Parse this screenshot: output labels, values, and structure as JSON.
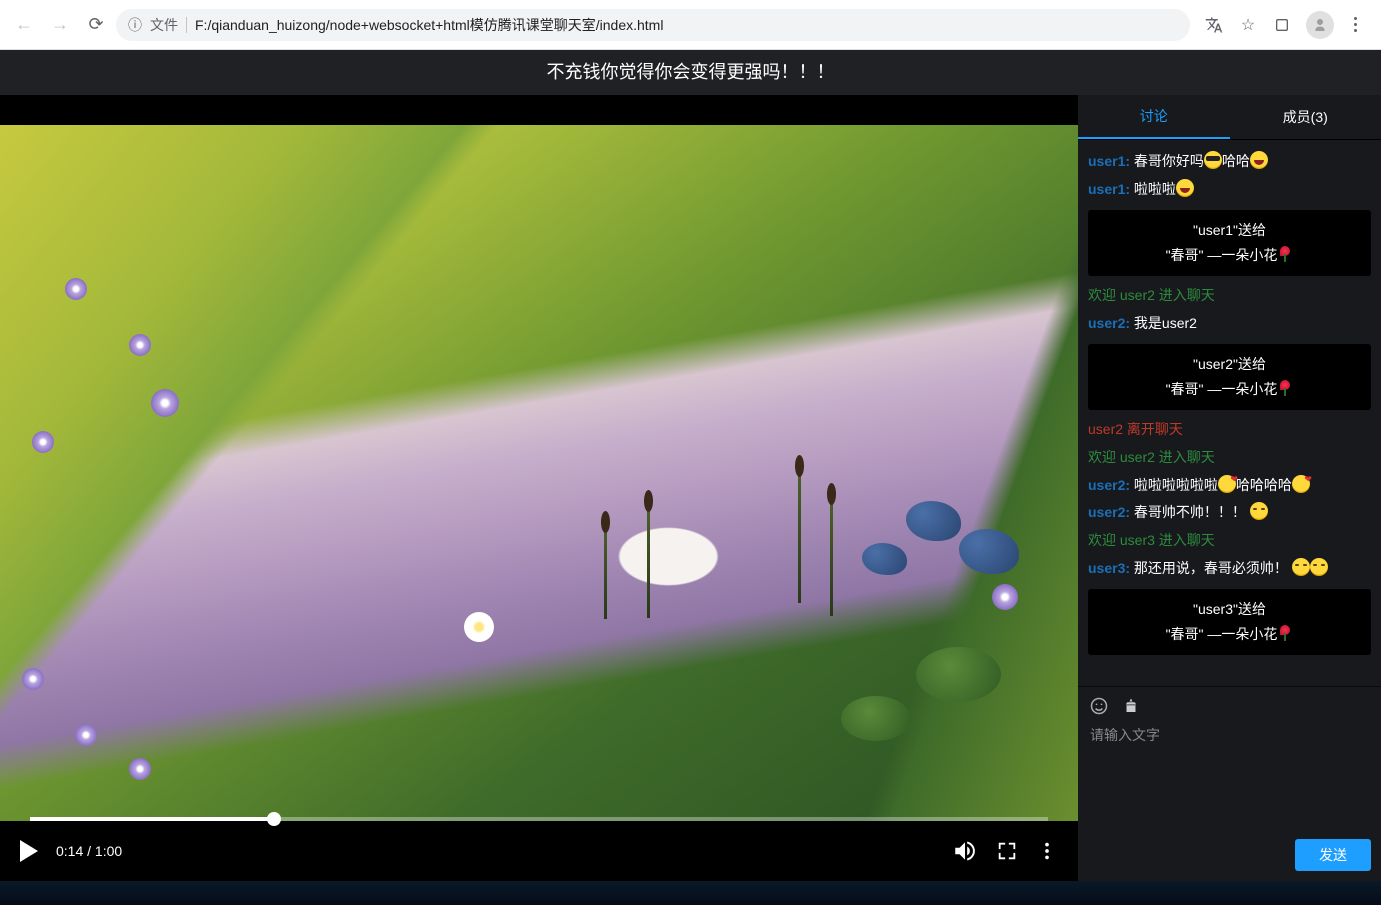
{
  "browser": {
    "file_label": "文件",
    "url": "F:/qianduan_huizong/node+websocket+html模仿腾讯课堂聊天室/index.html"
  },
  "banner": "不充钱你觉得你会变得更强吗！！！",
  "video": {
    "current_time": "0:14",
    "duration": "1:00",
    "progress_percent": 24
  },
  "chat": {
    "tabs": {
      "discuss": "讨论",
      "members": "成员(3)"
    },
    "messages": [
      {
        "type": "msg",
        "user": "user1",
        "uc": "c1",
        "parts": [
          "春哥你好吗",
          {
            "emoji": "cool"
          },
          "哈哈",
          {
            "emoji": "laugh"
          }
        ]
      },
      {
        "type": "msg",
        "user": "user1",
        "uc": "c1",
        "parts": [
          "啦啦啦",
          {
            "emoji": "laugh"
          }
        ]
      },
      {
        "type": "gift",
        "from": "user1",
        "to": "春哥",
        "item": "一朵小花"
      },
      {
        "type": "join",
        "user": "user2"
      },
      {
        "type": "msg",
        "user": "user2",
        "uc": "c2",
        "parts": [
          "我是user2"
        ]
      },
      {
        "type": "gift",
        "from": "user2",
        "to": "春哥",
        "item": "一朵小花"
      },
      {
        "type": "leave",
        "user": "user2"
      },
      {
        "type": "join",
        "user": "user2"
      },
      {
        "type": "msg",
        "user": "user2",
        "uc": "c2",
        "parts": [
          "啦啦啦啦啦啦",
          {
            "emoji": "heart"
          },
          "哈哈哈哈",
          {
            "emoji": "heart"
          }
        ]
      },
      {
        "type": "msg",
        "user": "user2",
        "uc": "c2",
        "parts": [
          "春哥帅不帅！！！ ",
          {
            "emoji": "think"
          }
        ]
      },
      {
        "type": "join",
        "user": "user3"
      },
      {
        "type": "msg",
        "user": "user3",
        "uc": "c3",
        "parts": [
          "那还用说，春哥必须帅！ ",
          {
            "emoji": "think"
          },
          {
            "emoji": "think"
          }
        ]
      },
      {
        "type": "gift",
        "from": "user3",
        "to": "春哥",
        "item": "一朵小花"
      }
    ],
    "sys_text": {
      "join_pre": "欢迎 ",
      "join_suf": " 进入聊天",
      "leave_suf": " 离开聊天",
      "gift_send": "送给"
    },
    "placeholder": "请输入文字",
    "send_label": "发送"
  }
}
